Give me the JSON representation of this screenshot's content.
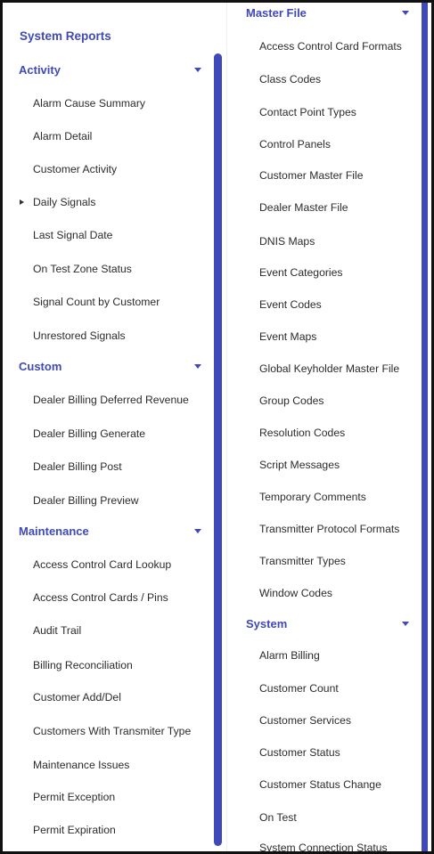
{
  "left_panel": {
    "title": "System Reports",
    "sections": [
      {
        "title": "Activity",
        "items": [
          "Alarm Cause Summary",
          "Alarm Detail",
          "Customer Activity",
          "Daily Signals",
          "Last Signal Date",
          "On Test Zone Status",
          "Signal Count by Customer",
          "Unrestored Signals"
        ]
      },
      {
        "title": "Custom",
        "items": [
          "Dealer Billing Deferred Revenue",
          "Dealer Billing Generate",
          "Dealer Billing Post",
          "Dealer Billing Preview"
        ]
      },
      {
        "title": "Maintenance",
        "items": [
          "Access Control Card Lookup",
          "Access Control Cards / Pins",
          "Audit Trail",
          "Billing Reconciliation",
          "Customer Add/Del",
          "Customers With Transmiter Type",
          "Maintenance Issues",
          "Permit Exception",
          "Permit Expiration"
        ]
      }
    ]
  },
  "right_panel": {
    "sections": [
      {
        "title": "Master File",
        "items": [
          "Access Control Card Formats",
          "Class Codes",
          "Contact Point Types",
          "Control Panels",
          "Customer Master File",
          "Dealer Master File",
          "DNIS Maps",
          "Event Categories",
          "Event Codes",
          "Event Maps",
          "Global Keyholder Master File",
          "Group Codes",
          "Resolution Codes",
          "Script Messages",
          "Temporary Comments",
          "Transmitter Protocol Formats",
          "Transmitter Types",
          "Window Codes"
        ]
      },
      {
        "title": "System",
        "items": [
          "Alarm Billing",
          "Customer Count",
          "Customer Services",
          "Customer Status",
          "Customer Status Change",
          "On Test",
          "System Connection Status"
        ]
      }
    ]
  },
  "colors": {
    "accent": "#3f49b8",
    "text": "#2b2b2b",
    "border": "#111111"
  }
}
